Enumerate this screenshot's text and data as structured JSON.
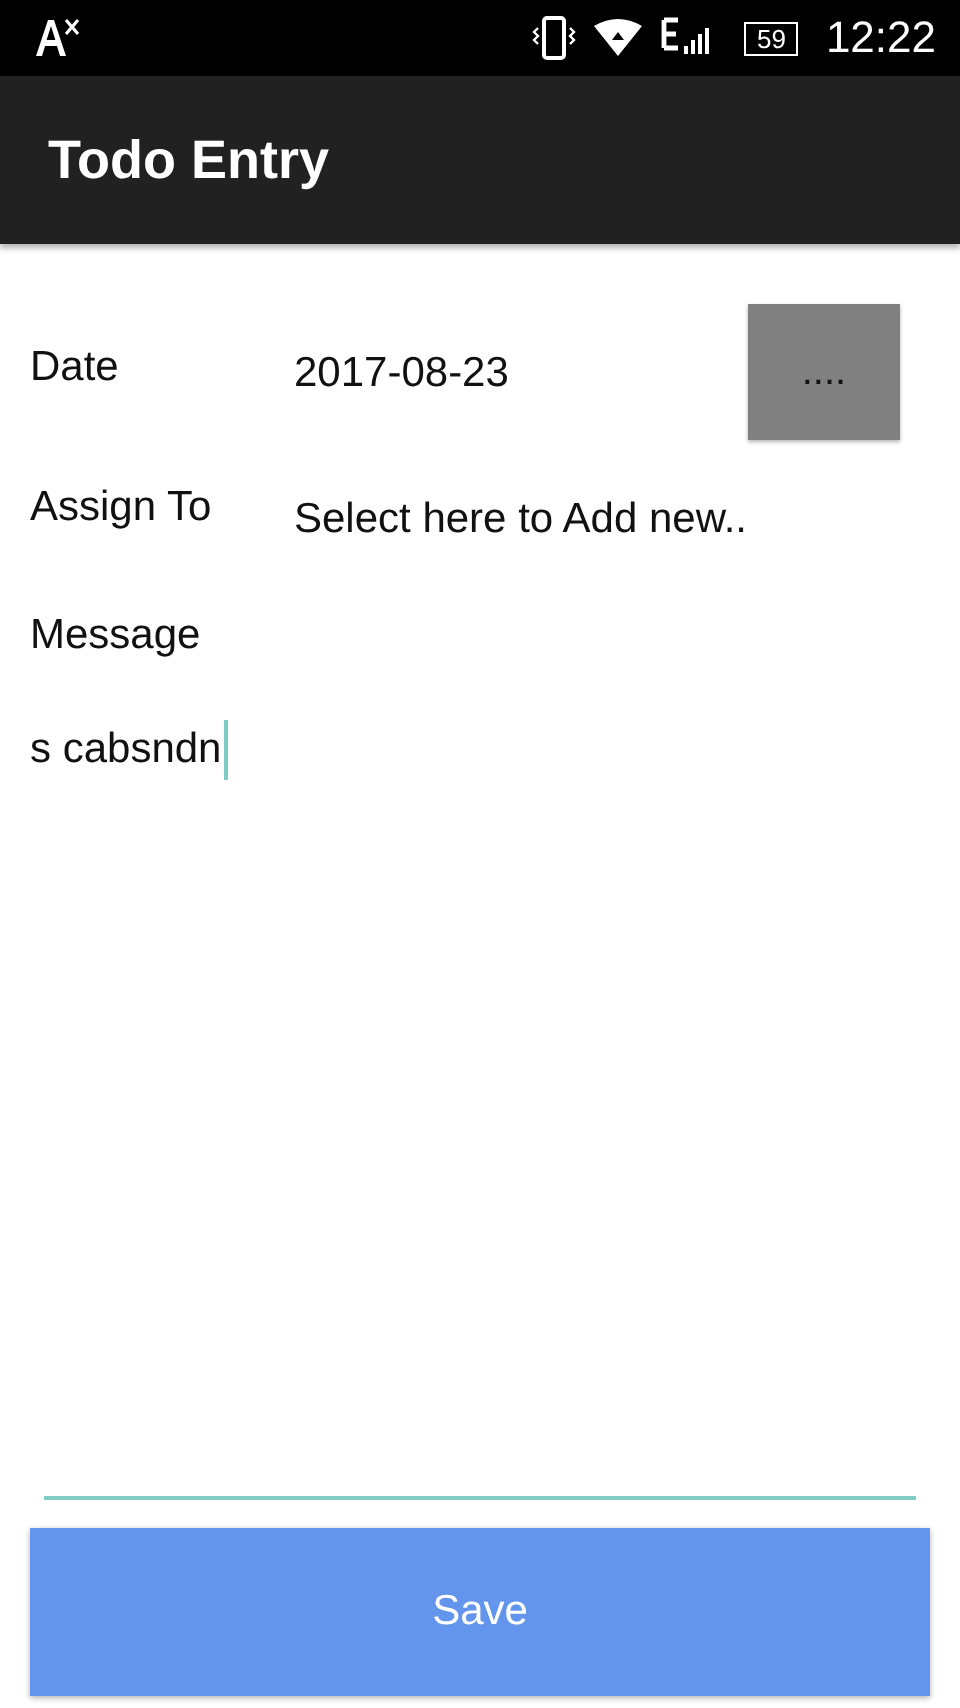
{
  "status_bar": {
    "battery": "59",
    "time": "12:22"
  },
  "app_bar": {
    "title": "Todo Entry"
  },
  "form": {
    "date_label": "Date",
    "date_value": "2017-08-23",
    "date_button": "....",
    "assign_label": "Assign To",
    "assign_value": "Select here to Add new..",
    "message_label": "Message",
    "message_value": "s cabsndn"
  },
  "buttons": [
    "Save"
  ]
}
